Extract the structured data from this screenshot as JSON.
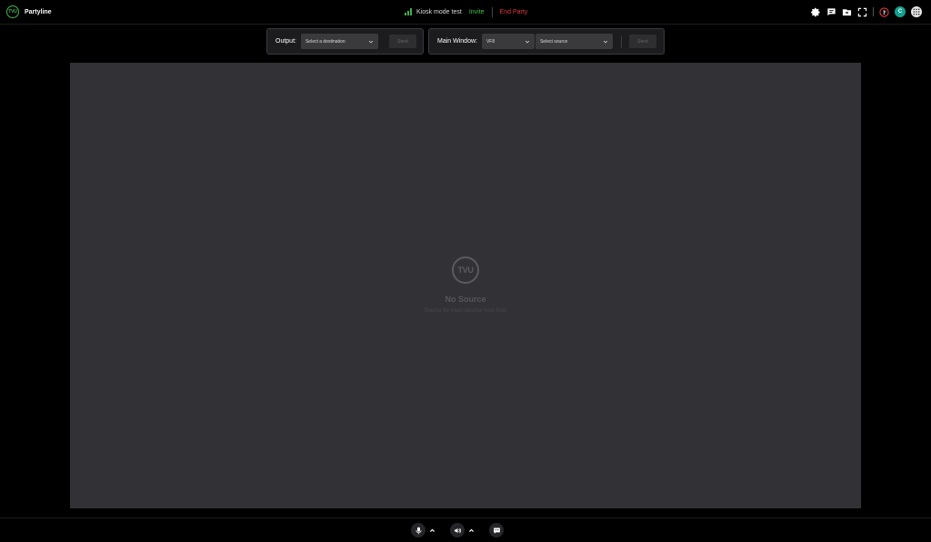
{
  "header": {
    "brand_logo_text": "TVU",
    "brand_name": "Partyline",
    "party_name": "Kiosk mode test",
    "invite_label": "Invite",
    "end_label": "End Party",
    "user_initial": "C"
  },
  "output_panel": {
    "label": "Output:",
    "destination_placeholder": "Select a destination",
    "send_label": "Send"
  },
  "main_window_panel": {
    "label": "Main Window:",
    "layout_value": "VF8",
    "source_placeholder": "Select source",
    "send_label": "Send"
  },
  "stage": {
    "logo_text": "TVU",
    "title": "No Source",
    "subtitle": "Source for main window from host"
  },
  "colors": {
    "accent_green": "#42c14b",
    "end_red": "#e0383c",
    "avatar_teal": "#14a090",
    "stage_bg": "#323236"
  },
  "icons": {
    "top_right": [
      "settings-icon",
      "chat-icon",
      "share-screen-icon",
      "fullscreen-icon",
      "help-icon",
      "avatar",
      "apps-grid-icon"
    ],
    "bottom": [
      "microphone-icon",
      "speaker-icon",
      "caption-icon"
    ]
  }
}
